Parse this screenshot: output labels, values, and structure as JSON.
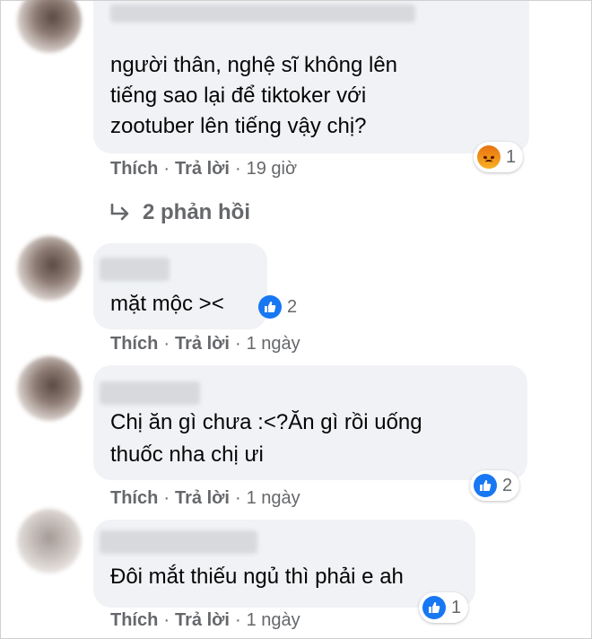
{
  "comments": [
    {
      "lines": [
        "người thân, nghệ sĩ không lên",
        "tiếng sao lại để tiktoker với",
        "zootuber lên tiếng vậy chị?"
      ],
      "reaction": {
        "icon": "angry-icon",
        "count": "1"
      },
      "actions": {
        "like": "Thích",
        "reply": "Trả lời",
        "time": "19 giờ"
      },
      "replies_label": "2 phản hồi"
    },
    {
      "lines": [
        "mặt mộc ><"
      ],
      "reaction": {
        "icon": "like-icon",
        "count": "2"
      },
      "actions": {
        "like": "Thích",
        "reply": "Trả lời",
        "time": "1 ngày"
      }
    },
    {
      "lines": [
        "Chị ăn gì chưa :<?Ăn gì rồi uống",
        "thuốc nha chị ưi"
      ],
      "reaction": {
        "icon": "like-icon",
        "count": "2"
      },
      "actions": {
        "like": "Thích",
        "reply": "Trả lời",
        "time": "1 ngày"
      }
    },
    {
      "lines": [
        "Đôi mắt thiếu ngủ thì phải e ah"
      ],
      "reaction": {
        "icon": "like-icon",
        "count": "1"
      },
      "actions": {
        "like": "Thích",
        "reply": "Trả lời",
        "time": "1 ngày"
      }
    }
  ],
  "separator": "·",
  "colors": {
    "bubble": "#f0f2f5",
    "meta": "#65676b",
    "like": "#1877f2",
    "angry": "#e9710f"
  }
}
